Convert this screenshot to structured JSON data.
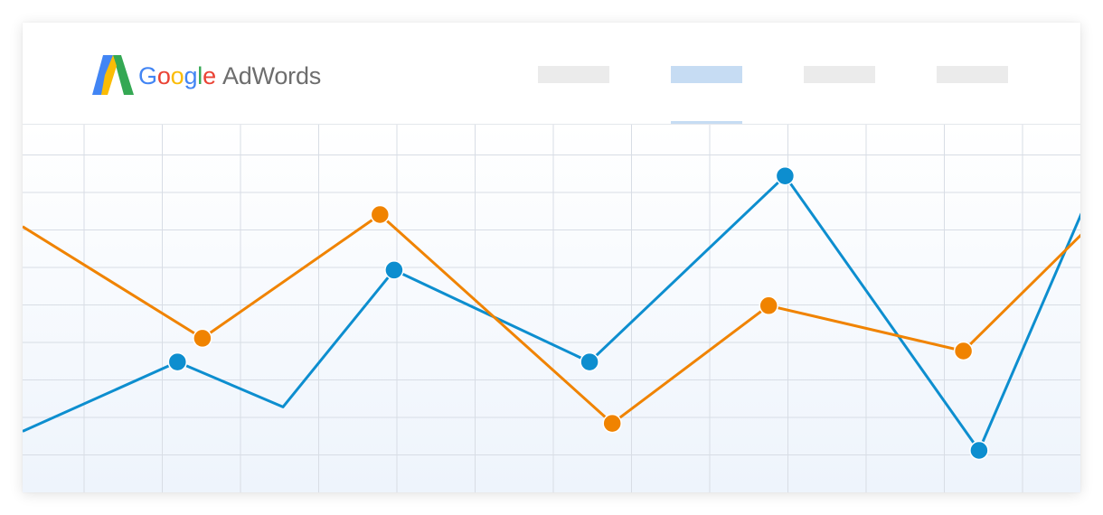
{
  "header": {
    "logo": {
      "icon": "adwords-logo-icon",
      "word_google": [
        "G",
        "o",
        "o",
        "g",
        "l",
        "e"
      ],
      "word_adwords": "AdWords",
      "letter_colors": [
        "#4285F4",
        "#EA4335",
        "#FBBC05",
        "#4285F4",
        "#34A853",
        "#EA4335"
      ],
      "adwords_color": "#6d6d6d",
      "mark_colors": {
        "blue": "#4285F4",
        "green": "#34A853",
        "yellow": "#FBBC05"
      }
    },
    "nav": {
      "tabs": [
        {
          "active": false
        },
        {
          "active": true
        },
        {
          "active": false
        },
        {
          "active": false
        }
      ]
    }
  },
  "chart_data": {
    "type": "line",
    "x": [
      0,
      1,
      2,
      3,
      4,
      5,
      6,
      7,
      8,
      9,
      10,
      11,
      12,
      13
    ],
    "grid": true,
    "colors": {
      "blue": "#0d8ecf",
      "orange": "#f08300",
      "grid": "#d8dde5"
    },
    "series": [
      {
        "color": "#0d8ecf",
        "points": [
          {
            "x": 0.0,
            "y": 1.63,
            "marker": false
          },
          {
            "x": 1.98,
            "y": 3.48,
            "marker": true
          },
          {
            "x": 3.33,
            "y": 2.28,
            "marker": false
          },
          {
            "x": 4.75,
            "y": 5.93,
            "marker": true
          },
          {
            "x": 7.25,
            "y": 3.48,
            "marker": true
          },
          {
            "x": 9.75,
            "y": 8.44,
            "marker": true
          },
          {
            "x": 12.23,
            "y": 1.12,
            "marker": true
          },
          {
            "x": 13.54,
            "y": 7.44,
            "marker": false
          }
        ]
      },
      {
        "color": "#f08300",
        "points": [
          {
            "x": 0.0,
            "y": 7.09,
            "marker": false
          },
          {
            "x": 2.3,
            "y": 4.11,
            "marker": true
          },
          {
            "x": 4.57,
            "y": 7.41,
            "marker": true
          },
          {
            "x": 7.54,
            "y": 1.84,
            "marker": true
          },
          {
            "x": 9.54,
            "y": 4.98,
            "marker": true
          },
          {
            "x": 12.03,
            "y": 3.77,
            "marker": true
          },
          {
            "x": 13.54,
            "y": 6.88,
            "marker": false
          }
        ]
      }
    ]
  }
}
